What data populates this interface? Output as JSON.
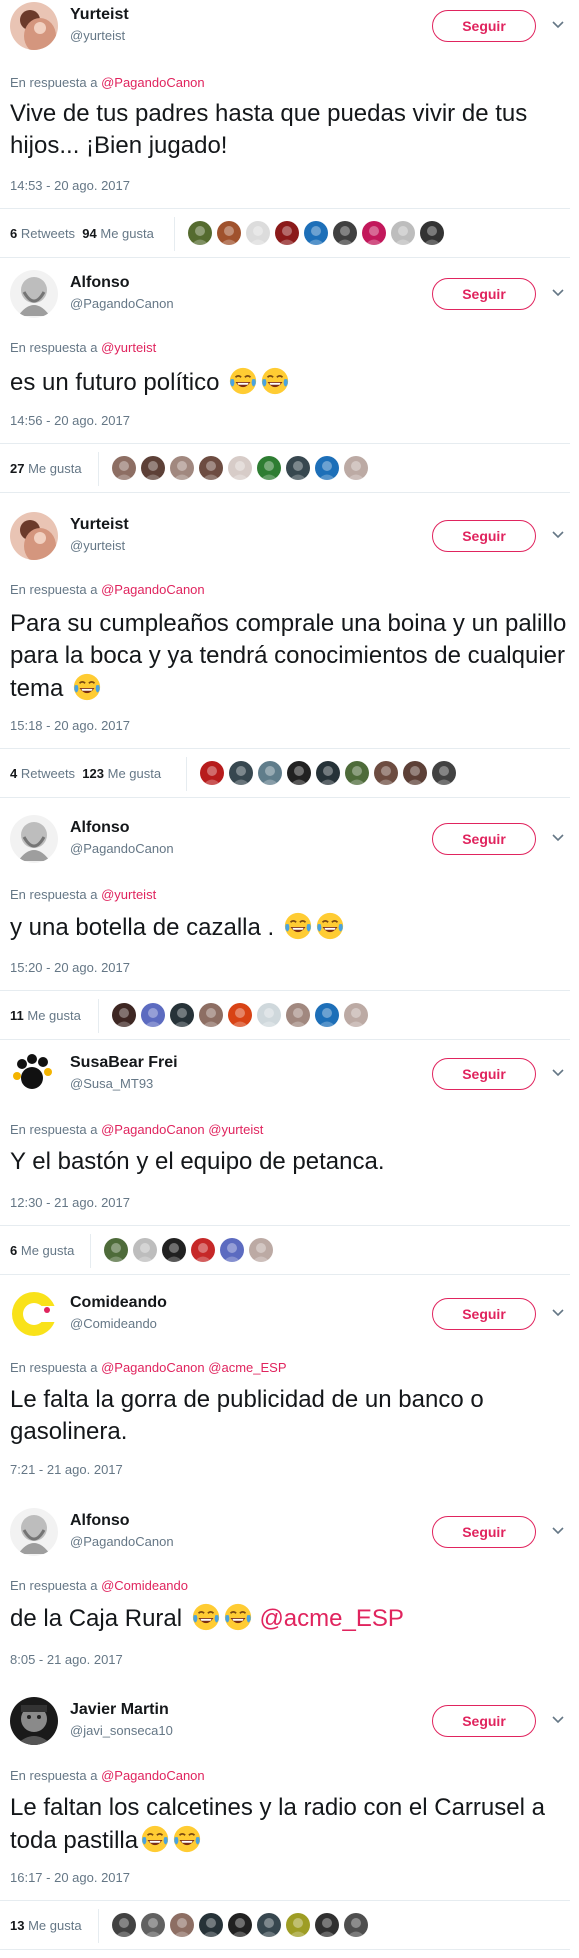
{
  "common": {
    "follow_label": "Seguir",
    "reply_prefix": "En respuesta a",
    "retweets_label": "Retweets",
    "likes_label": "Me gusta"
  },
  "tweets": [
    {
      "name": "Yurteist",
      "handle": "@yurteist",
      "reply_to": [
        "@PagandoCanon"
      ],
      "text": "Vive de tus padres hasta que puedas vivir de tus hijos... ¡Bien jugado!",
      "time": "14:53 - 20 ago. 2017",
      "retweets": "6",
      "likes": "94",
      "liker_colors": [
        "#556b2f",
        "#a0522d",
        "#dcdcdc",
        "#8b1a1a",
        "#1d6fb8",
        "#404040",
        "#c2185b",
        "#bdbdbd",
        "#333333"
      ]
    },
    {
      "name": "Alfonso",
      "handle": "@PagandoCanon",
      "reply_to": [
        "@yurteist"
      ],
      "text": "es un futuro político",
      "emoji_count": 2,
      "time": "14:56 - 20 ago. 2017",
      "likes": "27",
      "liker_colors": [
        "#8d6e63",
        "#5d4037",
        "#a1887f",
        "#6d4c41",
        "#d7ccc8",
        "#2e7d32",
        "#37474f",
        "#1d6fb8",
        "#bcaaa4"
      ]
    },
    {
      "name": "Yurteist",
      "handle": "@yurteist",
      "reply_to": [
        "@PagandoCanon"
      ],
      "text": "Para su cumpleaños comprale una boina y un palillo para la boca y ya tendrá conocimientos de cualquier tema",
      "emoji_count": 1,
      "time": "15:18 - 20 ago. 2017",
      "retweets": "4",
      "likes": "123",
      "liker_colors": [
        "#b71c1c",
        "#37474f",
        "#607d8b",
        "#212121",
        "#263238",
        "#4e6b3a",
        "#6d4c41",
        "#5d4037",
        "#424242"
      ]
    },
    {
      "name": "Alfonso",
      "handle": "@PagandoCanon",
      "reply_to": [
        "@yurteist"
      ],
      "text": "y una botella de cazalla .",
      "emoji_count": 2,
      "time": "15:20 - 20 ago. 2017",
      "likes": "11",
      "liker_colors": [
        "#3e2723",
        "#5c6bc0",
        "#263238",
        "#8d6e63",
        "#d84315",
        "#cfd8dc",
        "#a1887f",
        "#1d6fb8",
        "#bcaaa4"
      ]
    },
    {
      "name": "SusaBear Frei",
      "handle": "@Susa_MT93",
      "reply_to": [
        "@PagandoCanon",
        "@yurteist"
      ],
      "text": "Y el bastón y el equipo de petanca.",
      "time": "12:30 - 21 ago. 2017",
      "likes": "6",
      "liker_colors": [
        "#4e6b3a",
        "#bdbdbd",
        "#212121",
        "#c62828",
        "#5c6bc0",
        "#bcaaa4"
      ]
    },
    {
      "name": "Comideando",
      "handle": "@Comideando",
      "reply_to": [
        "@PagandoCanon",
        "@acme_ESP"
      ],
      "text": "Le falta la gorra de publicidad de un banco o gasolinera.",
      "time": "7:21 - 21 ago. 2017"
    },
    {
      "name": "Alfonso",
      "handle": "@PagandoCanon",
      "reply_to": [
        "@Comideando"
      ],
      "text": "de la Caja Rural",
      "emoji_count": 2,
      "trailing_mention": "@acme_ESP",
      "time": "8:05 - 21 ago. 2017"
    },
    {
      "name": "Javier Martin",
      "handle": "@javi_sonseca10",
      "reply_to": [
        "@PagandoCanon"
      ],
      "text": "Le faltan los calcetines y la radio con el Carrusel a toda pastilla",
      "emoji_count": 2,
      "time": "16:17 - 20 ago. 2017",
      "likes": "13",
      "liker_colors": [
        "#424242",
        "#616161",
        "#8d6e63",
        "#263238",
        "#212121",
        "#37474f",
        "#9e9d24",
        "#303030",
        "#4e4e4e"
      ]
    }
  ],
  "icons": {
    "chevron": "chevron-down-icon",
    "emoji": "tears-of-joy-emoji"
  }
}
